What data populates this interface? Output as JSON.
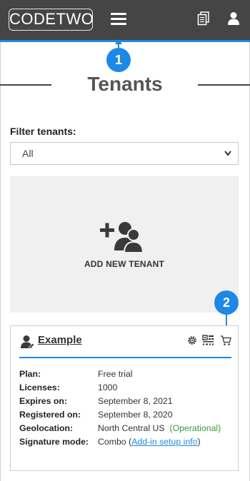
{
  "header": {
    "logo": "CODETWO",
    "menu_icon": "hamburger-menu-icon",
    "doc_icon": "documents-icon",
    "user_icon": "user-icon"
  },
  "markers": [
    "1",
    "2"
  ],
  "page": {
    "title": "Tenants"
  },
  "filter": {
    "label": "Filter tenants:",
    "selected": "All"
  },
  "add_tile": {
    "label": "ADD NEW TENANT",
    "icon": "add-user-group-icon"
  },
  "tenant": {
    "name": "Example",
    "tools": [
      "settings-icon",
      "qr-code-icon",
      "cart-icon"
    ],
    "fields": [
      {
        "key": "Plan:",
        "value": "Free trial"
      },
      {
        "key": "Licenses:",
        "value": "1000"
      },
      {
        "key": "Expires on:",
        "value": "September 8, 2021"
      },
      {
        "key": "Registered on:",
        "value": "September 8, 2020"
      },
      {
        "key": "Geolocation:",
        "value": "North Central US",
        "status": "(Operational)"
      },
      {
        "key": "Signature mode:",
        "value": "Combo",
        "paren_open": "(",
        "link": "Add-in setup info",
        "paren_close": ")"
      }
    ]
  },
  "colors": {
    "accent": "#1e88e5",
    "topbar": "#454545",
    "ok": "#3c9a3c"
  }
}
